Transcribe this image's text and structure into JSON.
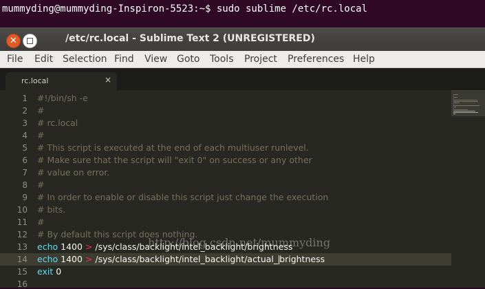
{
  "terminal": {
    "prompt": "mummyding@mummyding-Inspiron-5523:~$ sudo sublime /etc/rc.local"
  },
  "window": {
    "title": "/etc/rc.local - Sublime Text 2 (UNREGISTERED)",
    "close_glyph": "✕"
  },
  "menu": [
    "File",
    "Edit",
    "Selection",
    "Find",
    "View",
    "Goto",
    "Tools",
    "Project",
    "Preferences",
    "Help"
  ],
  "tab": {
    "label": "rc.local",
    "close_glyph": "×"
  },
  "editor": {
    "current_line": 14,
    "lines": [
      {
        "num": "1",
        "tokens": [
          {
            "t": "#!/bin/sh -e",
            "c": "c"
          }
        ]
      },
      {
        "num": "2",
        "tokens": [
          {
            "t": "#",
            "c": "c"
          }
        ]
      },
      {
        "num": "3",
        "tokens": [
          {
            "t": "# rc.local",
            "c": "c"
          }
        ]
      },
      {
        "num": "4",
        "tokens": [
          {
            "t": "#",
            "c": "c"
          }
        ]
      },
      {
        "num": "5",
        "tokens": [
          {
            "t": "# This script is executed at the end of each multiuser runlevel.",
            "c": "c"
          }
        ]
      },
      {
        "num": "6",
        "tokens": [
          {
            "t": "# Make sure that the script will \"exit 0\" on success or any other",
            "c": "c"
          }
        ]
      },
      {
        "num": "7",
        "tokens": [
          {
            "t": "# value on error.",
            "c": "c"
          }
        ]
      },
      {
        "num": "8",
        "tokens": [
          {
            "t": "#",
            "c": "c"
          }
        ]
      },
      {
        "num": "9",
        "tokens": [
          {
            "t": "# In order to enable or disable this script just change the execution",
            "c": "c"
          }
        ]
      },
      {
        "num": "10",
        "tokens": [
          {
            "t": "# bits.",
            "c": "c"
          }
        ]
      },
      {
        "num": "11",
        "tokens": [
          {
            "t": "#",
            "c": "c"
          }
        ]
      },
      {
        "num": "12",
        "tokens": [
          {
            "t": "# By default this script does nothing.",
            "c": "c"
          }
        ]
      },
      {
        "num": "13",
        "tokens": [
          {
            "t": "echo",
            "c": "k"
          },
          {
            "t": " 1400 ",
            "c": "n"
          },
          {
            "t": ">",
            "c": "o"
          },
          {
            "t": " /sys/class/backlight/intel_backlight/brightness",
            "c": "n"
          }
        ]
      },
      {
        "num": "14",
        "tokens": [
          {
            "t": "echo",
            "c": "k"
          },
          {
            "t": " 1400 ",
            "c": "n"
          },
          {
            "t": ">",
            "c": "o"
          },
          {
            "t": " /sys/class/backlight/intel_backlight/actual_",
            "c": "n"
          },
          {
            "t": "|",
            "c": "cursor"
          },
          {
            "t": "brightness",
            "c": "n"
          }
        ]
      },
      {
        "num": "15",
        "tokens": [
          {
            "t": "exit",
            "c": "k"
          },
          {
            "t": " 0",
            "c": "n"
          }
        ]
      },
      {
        "num": "16",
        "tokens": []
      }
    ]
  },
  "watermark": "http://blog.csdn.net/mummyding",
  "colors": {
    "terminal_bg": "#300a24",
    "editor_bg": "#272822",
    "comment": "#75715e",
    "keyword": "#66d9ef",
    "operator": "#f92672",
    "close_button": "#e25a24"
  }
}
